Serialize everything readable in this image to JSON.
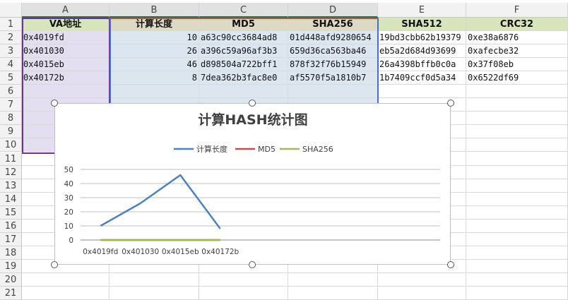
{
  "columns": [
    "A",
    "B",
    "C",
    "D",
    "E",
    "F"
  ],
  "rows": [
    "1",
    "2",
    "3",
    "4",
    "5",
    "6",
    "7",
    "8",
    "9",
    "10",
    "11",
    "12",
    "13",
    "14",
    "15",
    "16",
    "17",
    "18",
    "19",
    "20",
    "21"
  ],
  "header_row": [
    "VA地址",
    "计算长度",
    "MD5",
    "SHA256",
    "SHA512",
    "CRC32"
  ],
  "data_rows": [
    [
      "0x4019fd",
      "10",
      "a63c90cc3684ad8",
      "01d448afd9280654",
      "19bd3cbb62b19379",
      "0xe38a6876"
    ],
    [
      "0x401030",
      "26",
      "a396c59a96af3b3",
      "659d36ca563ba46",
      "eb5a2d684d93699",
      "0xafecbe32"
    ],
    [
      "0x4015eb",
      "46",
      "d898504a722bff1",
      "878f32f76b15949",
      "26a4398bffb0c0a",
      "0x37f08eb"
    ],
    [
      "0x40172b",
      "8",
      "7dea362b3fac8e0",
      "af5570f5a1810b7",
      "1b7409ccf0d5a34",
      "0x6522df69"
    ]
  ],
  "colors": {
    "header_fill": "#d8e4bc",
    "header_fill_b_d": "#ddd9c4",
    "range_a": "#e4dff0",
    "range_bd": "#dce6f1",
    "series_1": "#4f81bd",
    "series_2": "#c0504d",
    "series_3": "#9bbb59"
  },
  "chart_data": {
    "type": "line",
    "title": "计算HASH统计图",
    "categories": [
      "0x4019fd",
      "0x401030",
      "0x4015eb",
      "0x40172b"
    ],
    "series": [
      {
        "name": "计算长度",
        "values": [
          10,
          26,
          46,
          8
        ]
      },
      {
        "name": "MD5",
        "values": [
          0,
          0,
          0,
          0
        ]
      },
      {
        "name": "SHA256",
        "values": [
          0,
          0,
          0,
          0
        ]
      }
    ],
    "ylim": [
      0,
      50
    ],
    "yticks": [
      0,
      10,
      20,
      30,
      40,
      50
    ],
    "grid": true,
    "legend": "top"
  }
}
